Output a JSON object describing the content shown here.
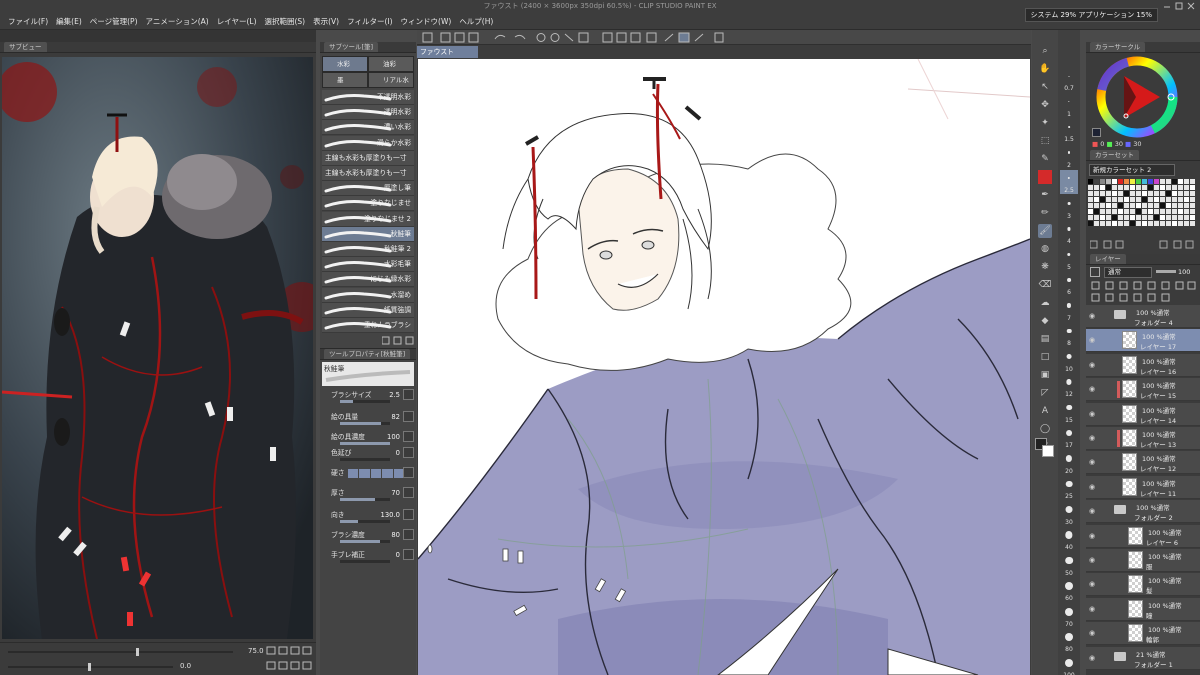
{
  "window": {
    "title": "ファウスト (2400 × 3600px 350dpi 60.5%) - CLIP STUDIO PAINT EX"
  },
  "menu": [
    "ファイル(F)",
    "編集(E)",
    "ページ管理(P)",
    "アニメーション(A)",
    "レイヤー(L)",
    "選択範囲(S)",
    "表示(V)",
    "フィルター(I)",
    "ウィンドウ(W)",
    "ヘルプ(H)"
  ],
  "system": {
    "label": "システム 29% アプリケーション 15%"
  },
  "subview": {
    "tab": "サブビュー",
    "zoom": "75.0",
    "rotation": "0.0"
  },
  "subtool": {
    "header": "サブツール[筆]",
    "groups": [
      {
        "label": "水彩",
        "selected": true
      },
      {
        "label": "油彩",
        "selected": false
      },
      {
        "label": "墨",
        "selected": false
      },
      {
        "label": "リアル水彩",
        "selected": false
      }
    ],
    "brushes": [
      {
        "label": "不透明水彩",
        "selected": false,
        "left": false
      },
      {
        "label": "透明水彩",
        "selected": false,
        "left": false
      },
      {
        "label": "濃い水彩",
        "selected": false,
        "left": false
      },
      {
        "label": "滑らか水彩",
        "selected": false,
        "left": false
      },
      {
        "label": "主線も水彩も厚塗りも一寸",
        "selected": false,
        "left": true
      },
      {
        "label": "主線も水彩も厚塗りも一寸",
        "selected": false,
        "left": true
      },
      {
        "label": "厚塗し筆",
        "selected": false,
        "left": false
      },
      {
        "label": "塗りなじませ",
        "selected": false,
        "left": false
      },
      {
        "label": "塗りなじませ 2",
        "selected": false,
        "left": false
      },
      {
        "label": "秋鮭筆",
        "selected": true,
        "left": false
      },
      {
        "label": "秋鮭筆 2",
        "selected": false,
        "left": false
      },
      {
        "label": "水彩毛筆",
        "selected": false,
        "left": false
      },
      {
        "label": "にじみ縁水彩",
        "selected": false,
        "left": false
      },
      {
        "label": "水溜め",
        "selected": false,
        "left": false
      },
      {
        "label": "紙質強調",
        "selected": false,
        "left": false
      },
      {
        "label": "重ねムラブラシ",
        "selected": false,
        "left": false
      }
    ]
  },
  "toolprop": {
    "header": "ツールプロパティ[秋鮭筆]",
    "name": "秋鮭筆",
    "rows": [
      {
        "label": "ブラシサイズ",
        "value": "2.5",
        "fill": 0.25
      },
      {
        "label": "絵の具量",
        "value": "82",
        "fill": 0.82
      },
      {
        "label": "絵の具濃度",
        "value": "100",
        "fill": 1.0
      },
      {
        "label": "色延び",
        "value": "0",
        "fill": 0.0
      },
      {
        "label": "硬さ",
        "value": "",
        "fill": 0.0
      },
      {
        "label": "厚さ",
        "value": "70",
        "fill": 0.7
      },
      {
        "label": "向き",
        "value": "130.0",
        "fill": 0.36
      },
      {
        "label": "ブラシ濃度",
        "value": "80",
        "fill": 0.8
      },
      {
        "label": "手ブレ補正",
        "value": "0",
        "fill": 0.0
      }
    ]
  },
  "canvas": {
    "doc_tab": "ファウスト"
  },
  "brush_sizes": [
    "0.7",
    "1",
    "1.5",
    "2",
    "2.5",
    "3",
    "4",
    "5",
    "6",
    "7",
    "8",
    "10",
    "12",
    "15",
    "17",
    "20",
    "25",
    "30",
    "40",
    "50",
    "60",
    "70",
    "80",
    "100"
  ],
  "color_circle": {
    "header": "カラーサークル",
    "h": "0",
    "s": "30",
    "v": "30"
  },
  "color_set": {
    "header": "カラーセット",
    "selected": "新規カラーセット 2"
  },
  "layers": {
    "header": "レイヤー",
    "blend": "通常",
    "opacity": "100",
    "rows": [
      {
        "l1": "100 %通常",
        "l2": "フォルダー 4",
        "folder": true,
        "selected": false,
        "mark": false,
        "indent": 0
      },
      {
        "l1": "100 %通常",
        "l2": "レイヤー 17",
        "folder": false,
        "selected": true,
        "mark": false,
        "indent": 1
      },
      {
        "l1": "100 %通常",
        "l2": "レイヤー 16",
        "folder": false,
        "selected": false,
        "mark": false,
        "indent": 1
      },
      {
        "l1": "100 %通常",
        "l2": "レイヤー 15",
        "folder": false,
        "selected": false,
        "mark": true,
        "indent": 1
      },
      {
        "l1": "100 %通常",
        "l2": "レイヤー 14",
        "folder": false,
        "selected": false,
        "mark": false,
        "indent": 1
      },
      {
        "l1": "100 %通常",
        "l2": "レイヤー 13",
        "folder": false,
        "selected": false,
        "mark": true,
        "indent": 1
      },
      {
        "l1": "100 %通常",
        "l2": "レイヤー 12",
        "folder": false,
        "selected": false,
        "mark": false,
        "indent": 1
      },
      {
        "l1": "100 %通常",
        "l2": "レイヤー 11",
        "folder": false,
        "selected": false,
        "mark": false,
        "indent": 1
      },
      {
        "l1": "100 %通常",
        "l2": "フォルダー 2",
        "folder": true,
        "selected": false,
        "mark": false,
        "indent": 0
      },
      {
        "l1": "100 %通常",
        "l2": "レイヤー 6",
        "folder": false,
        "selected": false,
        "mark": false,
        "indent": 2
      },
      {
        "l1": "100 %通常",
        "l2": "服",
        "folder": false,
        "selected": false,
        "mark": false,
        "indent": 2
      },
      {
        "l1": "100 %通常",
        "l2": "髪",
        "folder": false,
        "selected": false,
        "mark": false,
        "indent": 2
      },
      {
        "l1": "100 %通常",
        "l2": "瞳",
        "folder": false,
        "selected": false,
        "mark": false,
        "indent": 2
      },
      {
        "l1": "100 %通常",
        "l2": "輪郭",
        "folder": false,
        "selected": false,
        "mark": false,
        "indent": 2
      },
      {
        "l1": "21 %通常",
        "l2": "フォルダー 1",
        "folder": true,
        "selected": false,
        "mark": false,
        "indent": 0
      }
    ]
  }
}
